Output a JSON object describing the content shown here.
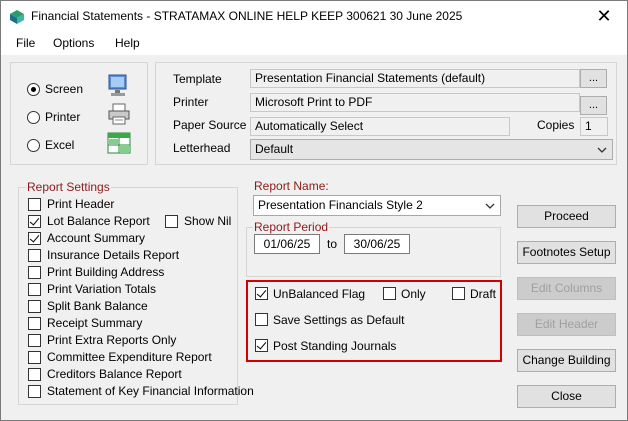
{
  "window": {
    "title": "Financial Statements - STRATAMAX ONLINE HELP KEEP 300621 30 June 2025",
    "close_glyph": "✕"
  },
  "menu": {
    "items": [
      "File",
      "Options",
      "Help"
    ]
  },
  "output": {
    "selected": "Screen",
    "options": [
      {
        "label": "Screen",
        "icon": "monitor-icon"
      },
      {
        "label": "Printer",
        "icon": "printer-icon"
      },
      {
        "label": "Excel",
        "icon": "spreadsheet-icon"
      }
    ]
  },
  "settings": {
    "template_label": "Template",
    "template_value": "Presentation Financial Statements (default)",
    "printer_label": "Printer",
    "printer_value": "Microsoft Print to PDF",
    "paper_source_label": "Paper Source",
    "paper_source_value": "Automatically Select",
    "copies_label": "Copies",
    "copies_value": "1",
    "letterhead_label": "Letterhead",
    "letterhead_value": "Default",
    "browse_label": "..."
  },
  "report_settings": {
    "title": "Report Settings",
    "items": [
      {
        "label": "Print Header",
        "checked": false
      },
      {
        "label": "Lot Balance Report",
        "checked": true
      },
      {
        "label": "Account Summary",
        "checked": true
      },
      {
        "label": "Insurance Details Report",
        "checked": false
      },
      {
        "label": "Print Building Address",
        "checked": false
      },
      {
        "label": "Print Variation Totals",
        "checked": false
      },
      {
        "label": "Split Bank Balance",
        "checked": false
      },
      {
        "label": "Receipt Summary",
        "checked": false
      },
      {
        "label": "Print Extra Reports Only",
        "checked": false
      },
      {
        "label": "Committee Expenditure Report",
        "checked": false
      },
      {
        "label": "Creditors Balance Report",
        "checked": false
      },
      {
        "label": "Statement of Key Financial Information",
        "checked": false
      }
    ],
    "show_nil": {
      "label": "Show Nil",
      "checked": false
    }
  },
  "report_name": {
    "label": "Report Name:",
    "value": "Presentation Financials Style 2"
  },
  "report_period": {
    "label": "Report Period",
    "from": "01/06/25",
    "to_label": "to",
    "to": "30/06/25"
  },
  "flags": {
    "unbalanced": {
      "label": "UnBalanced Flag",
      "checked": true
    },
    "only": {
      "label": "Only",
      "checked": false
    },
    "draft": {
      "label": "Draft",
      "checked": false
    },
    "save_default": {
      "label": "Save Settings as Default",
      "checked": false
    },
    "post_journals": {
      "label": "Post Standing Journals",
      "checked": true
    }
  },
  "buttons": {
    "proceed": "Proceed",
    "footnotes": "Footnotes Setup",
    "edit_columns": "Edit Columns",
    "edit_header": "Edit Header",
    "change_building": "Change Building",
    "close": "Close"
  },
  "colors": {
    "group_title": "#8b1a1a",
    "highlight": "#d20000",
    "window_bg": "#f0f0f0"
  }
}
